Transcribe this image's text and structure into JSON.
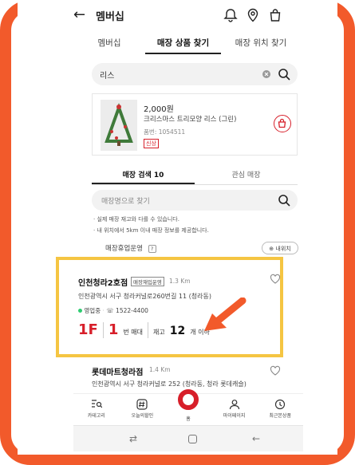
{
  "header": {
    "back_icon": "arrow-left-icon",
    "title": "멤버십"
  },
  "tabs": [
    {
      "label": "멤버십"
    },
    {
      "label": "매장 상품 찾기"
    },
    {
      "label": "매장 위치 찾기"
    }
  ],
  "search": {
    "value": "리스"
  },
  "product": {
    "price": "2,000원",
    "name": "크리스마스 트리모양 리스 (그린)",
    "code_label": "품번",
    "code": "1054511",
    "badge": "신상"
  },
  "subtabs": [
    {
      "label": "매장 검색 10"
    },
    {
      "label": "관심 매장"
    }
  ],
  "store_search": {
    "placeholder": "매장명으로 찾기"
  },
  "notes": [
    "· 실제 매장 재고와 다를 수 있습니다.",
    "· 내 위치에서 5km 이내 매장 정보를 제공합니다."
  ],
  "filter": {
    "label": "매장휴업운영",
    "badge": "?",
    "location_button": "내위치"
  },
  "stores": [
    {
      "name": "인천청라2호점",
      "tag": "매장재입운영",
      "distance": "1.3 Km",
      "address": "인천광역시 서구 청라커널로260번길 11 (청라동)",
      "status": "영업중",
      "phone": "1522-4400",
      "floor": "1F",
      "aisle_number": "1",
      "aisle_label": "번 매대",
      "stock_prefix": "재고",
      "stock_number": "12",
      "stock_suffix": "개 이하"
    },
    {
      "name": "롯데마트청라점",
      "distance": "1.4 Km",
      "address": "인천광역시 서구 청라커널로 252 (청라동, 청라 롯데캐슬)"
    }
  ],
  "bottom_nav": [
    {
      "label": "카테고리",
      "icon": "category-search-icon"
    },
    {
      "label": "오늘의할인",
      "icon": "hashtag-icon"
    },
    {
      "label": "홈",
      "icon": "home-circle-icon"
    },
    {
      "label": "마이페이지",
      "icon": "person-icon"
    },
    {
      "label": "최근본상품",
      "icon": "history-icon"
    }
  ],
  "colors": {
    "accent": "#d71f2a",
    "frame": "#f25a2b",
    "highlight": "#f5c542"
  }
}
